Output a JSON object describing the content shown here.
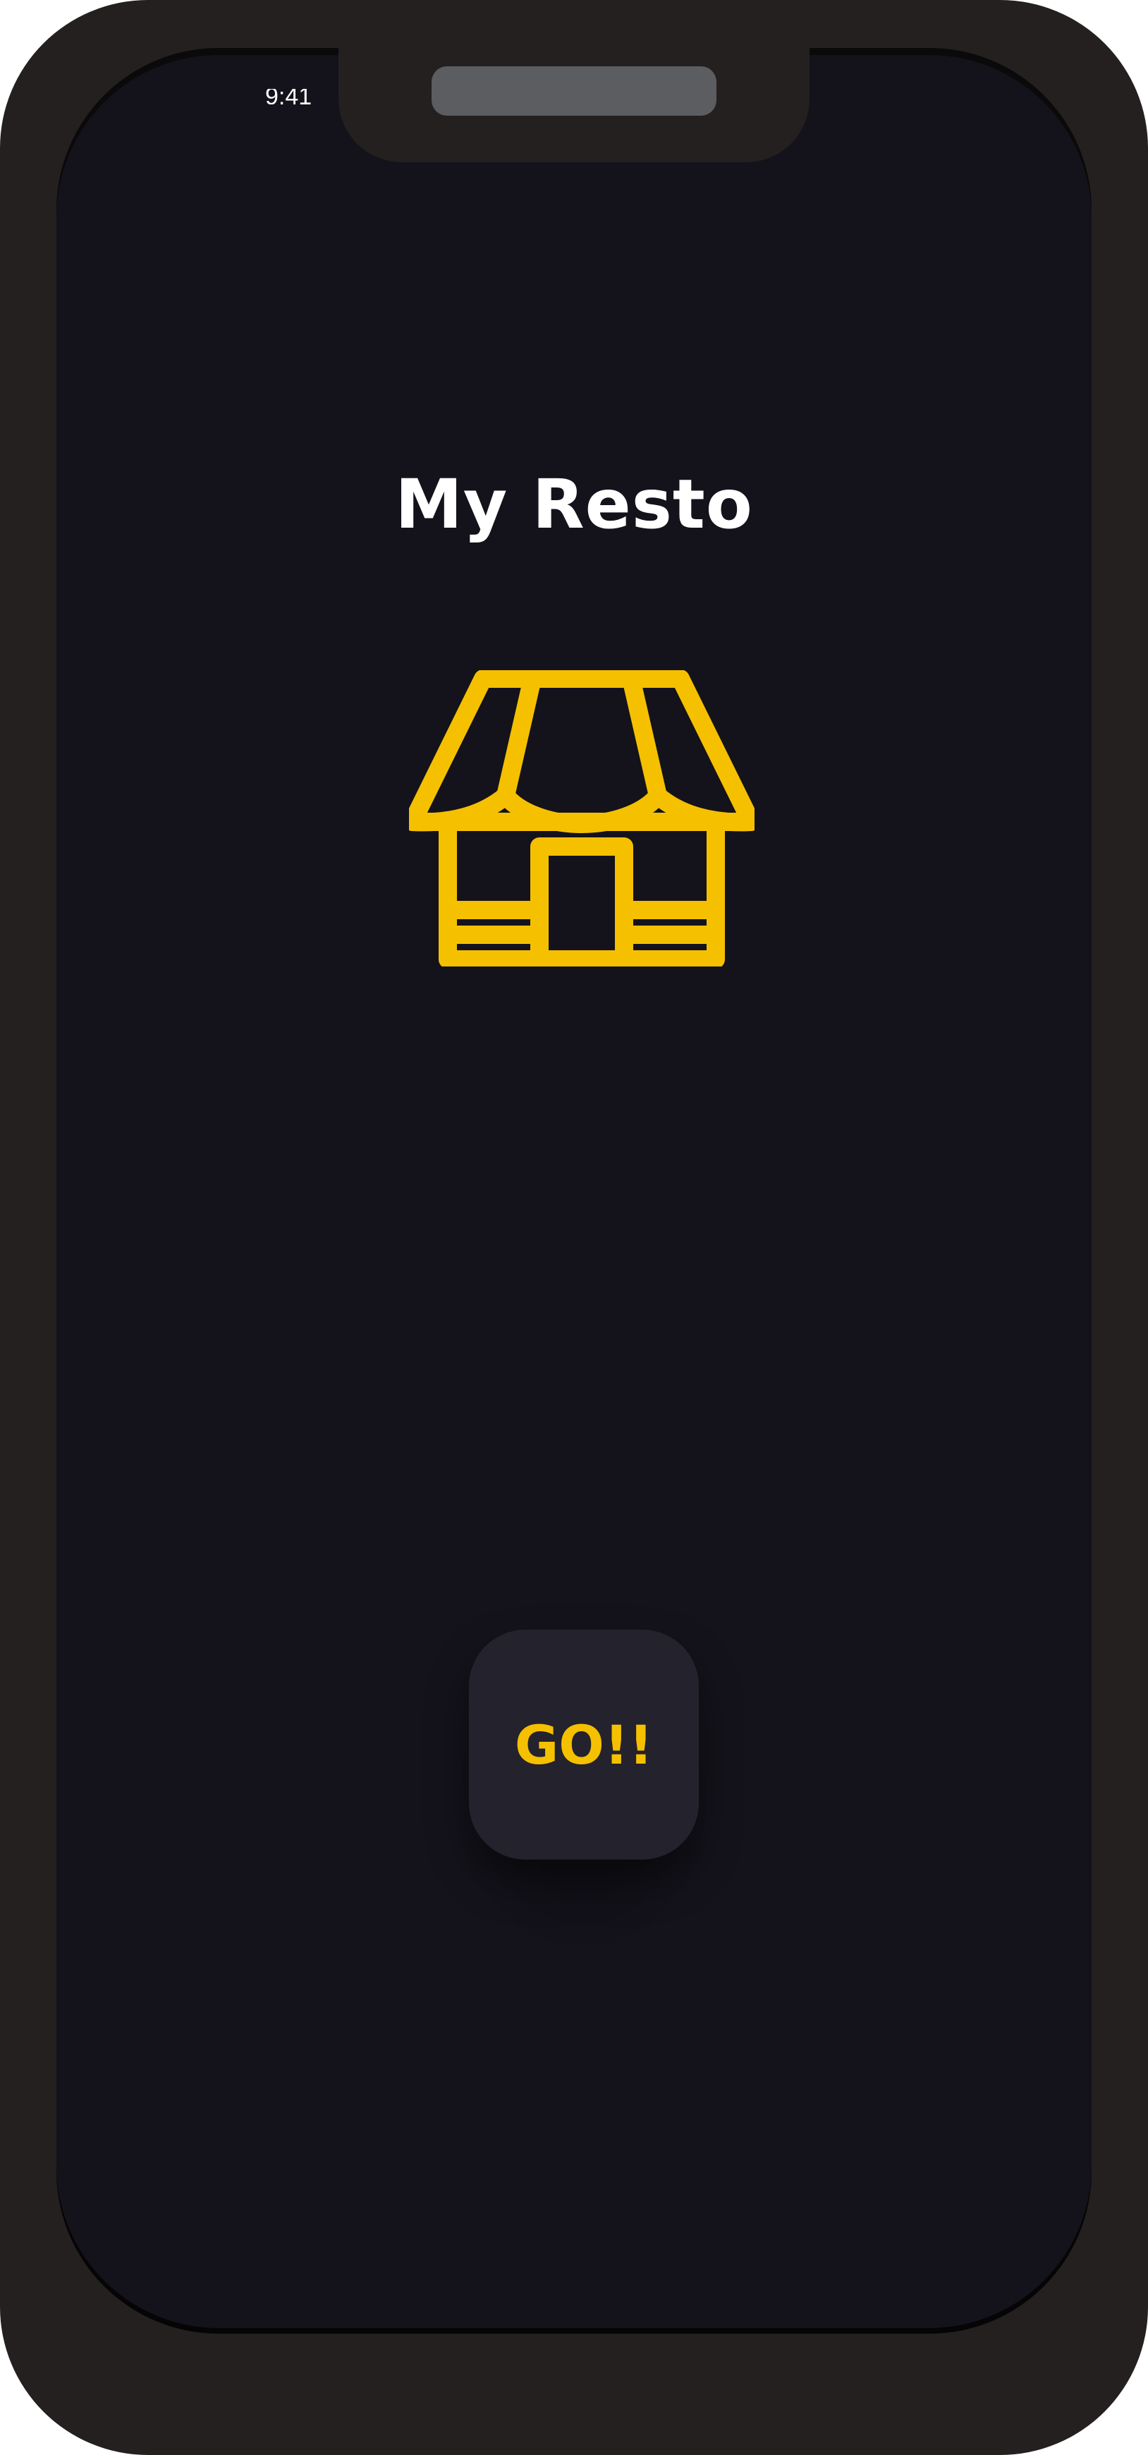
{
  "app": {
    "title": "My Resto"
  },
  "status_bar": {
    "text": "9:41"
  },
  "hero": {
    "icon": "store-icon",
    "icon_color": "#f5c000"
  },
  "actions": {
    "go_label": "GO!!"
  },
  "colors": {
    "frame": "#242020",
    "screen_background": "#14131b",
    "button_background": "#24222c",
    "accent": "#f5c000",
    "title_text": "#ffffff"
  }
}
